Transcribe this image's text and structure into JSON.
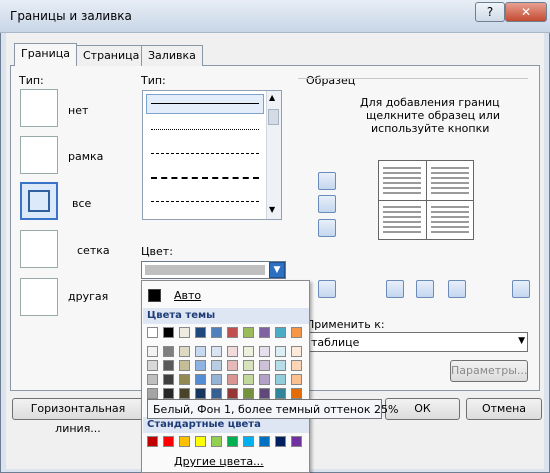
{
  "window": {
    "title": "Границы и заливка",
    "help_label": "?",
    "close_label": "✕"
  },
  "tabs": [
    {
      "label": "Граница"
    },
    {
      "label": "Страница"
    },
    {
      "label": "Заливка"
    }
  ],
  "setting": {
    "label": "Тип:",
    "items": [
      {
        "label": "нет"
      },
      {
        "label": "рамка"
      },
      {
        "label": "все"
      },
      {
        "label": "сетка"
      },
      {
        "label": "другая"
      }
    ]
  },
  "style": {
    "label": "Тип:"
  },
  "color": {
    "label": "Цвет:"
  },
  "preview": {
    "label": "Образец",
    "hint_line1": "Для добавления границ",
    "hint_line2": "щелкните образец или",
    "hint_line3": "используйте кнопки"
  },
  "apply_to": {
    "label": "Применить к:",
    "value": "таблице"
  },
  "params_button": "Параметры...",
  "palette": {
    "auto_label": "Авто",
    "theme_header": "Цвета темы",
    "standard_header": "Стандартные цвета",
    "more_colors": "Другие цвета...",
    "theme_top": [
      "#ffffff",
      "#000000",
      "#eeece1",
      "#1f497d",
      "#4f81bd",
      "#c0504d",
      "#9bbb59",
      "#8064a2",
      "#4bacc6",
      "#f79646"
    ],
    "theme_shades": [
      [
        "#f2f2f2",
        "#7f7f7f",
        "#ddd9c3",
        "#c6d9f0",
        "#dbe5f1",
        "#f2dcdb",
        "#ebf1dd",
        "#e5e0ec",
        "#dbeef3",
        "#fdeada"
      ],
      [
        "#d8d8d8",
        "#595959",
        "#c4bd97",
        "#8db3e2",
        "#b8cce4",
        "#e5b9b7",
        "#d7e3bc",
        "#ccc1d9",
        "#b7dde8",
        "#fbd5b5"
      ],
      [
        "#bfbfbf",
        "#3f3f3f",
        "#938953",
        "#548dd4",
        "#95b3d7",
        "#d99694",
        "#c3d69b",
        "#b2a2c7",
        "#92cddc",
        "#fac08f"
      ],
      [
        "#a5a5a5",
        "#262626",
        "#494429",
        "#17365d",
        "#366092",
        "#953734",
        "#76923c",
        "#5f497a",
        "#31859b",
        "#e36c09"
      ],
      [
        "#7f7f7f",
        "#0c0c0c",
        "#1d1b10",
        "#0f243e",
        "#244061",
        "#632423",
        "#4f6128",
        "#3f3151",
        "#205867",
        "#974806"
      ]
    ],
    "standard": [
      "#c00000",
      "#ff0000",
      "#ffc000",
      "#ffff00",
      "#92d050",
      "#00b050",
      "#00b0f0",
      "#0070c0",
      "#002060",
      "#7030a0"
    ]
  },
  "tooltip": "Белый, Фон 1, более темный оттенок 25%",
  "footer": {
    "horizontal_line": "Горизонтальная линия...",
    "ok": "ОК",
    "cancel": "Отмена"
  }
}
